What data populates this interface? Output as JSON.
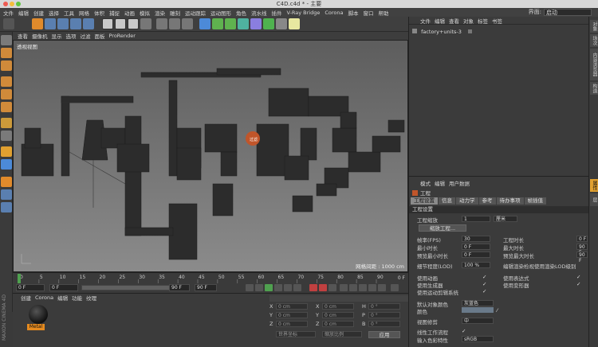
{
  "window": {
    "title": "C4D.c4d * - 主要"
  },
  "menubar": {
    "items": [
      "文件",
      "编辑",
      "创建",
      "选择",
      "工具",
      "网格",
      "体积",
      "捕捉",
      "动画",
      "模拟",
      "渲染",
      "雕刻",
      "运动跟踪",
      "运动图形",
      "角色",
      "流水线",
      "插件",
      "V-Ray Bridge",
      "Corona",
      "脚本",
      "窗口",
      "帮助"
    ],
    "layout_label": "界面:",
    "layout_value": "启动"
  },
  "viewport": {
    "menu": [
      "查看",
      "摄像机",
      "显示",
      "选项",
      "过滤",
      "面板",
      "ProRender"
    ],
    "label": "透视视图",
    "grid_distance": "网格间距 : 1000 cm",
    "highlight_tag": "过滤"
  },
  "timeline": {
    "ticks": [
      "0",
      "5",
      "10",
      "15",
      "20",
      "25",
      "30",
      "35",
      "40",
      "45",
      "50",
      "55",
      "60",
      "65",
      "70",
      "75",
      "80",
      "85",
      "90"
    ],
    "end_label": "0 F"
  },
  "transport": {
    "current": "0 F",
    "start": "0 F",
    "end": "90 F",
    "end2": "90 F"
  },
  "material": {
    "menu": [
      "创建",
      "Corona",
      "编辑",
      "功能",
      "纹理"
    ],
    "name": "Metal"
  },
  "coords": {
    "rows": [
      {
        "a": "X",
        "av": "0 cm",
        "b": "X",
        "bv": "0 cm",
        "c": "H",
        "cv": "0 °"
      },
      {
        "a": "Y",
        "av": "0 cm",
        "b": "Y",
        "bv": "0 cm",
        "c": "P",
        "cv": "0 °"
      },
      {
        "a": "Z",
        "av": "0 cm",
        "b": "Z",
        "bv": "0 cm",
        "c": "B",
        "cv": "0 °"
      }
    ],
    "mode1": "世界坐标",
    "mode2": "缩放比例",
    "apply": "应用"
  },
  "object_manager": {
    "menu": [
      "文件",
      "编辑",
      "查看",
      "对象",
      "标签",
      "书签"
    ],
    "object": "factory+units-3"
  },
  "attributes": {
    "menu": [
      "模式",
      "编辑",
      "用户数据"
    ],
    "title": "工程",
    "tabs": [
      "工程设置",
      "信息",
      "动力学",
      "参考",
      "待办事项",
      "帧插值"
    ],
    "section": "工程设置",
    "scale_label": "工程缩放",
    "scale_value": "1",
    "scale_unit": "厘米",
    "scale_button": "缩放工程...",
    "fps_label": "帧率(FPS)",
    "fps_value": "30",
    "min_label": "最小时长",
    "min_value": "0 F",
    "prev_min_label": "预览最小时长",
    "prev_min_value": "0 F",
    "proj_time_label": "工程时长",
    "proj_time_value": "0 F",
    "max_label": "最大时长",
    "max_value": "90 F",
    "prev_max_label": "预览最大时长",
    "prev_max_value": "90 F",
    "lod_label": "细节程度(LOD)",
    "lod_value": "100 %",
    "lod_check_label": "编辑渲染检视使用渲染LOD级别",
    "anim_label": "使用动画",
    "expr_label": "使用表达式",
    "gen_label": "使用生成器",
    "deform_label": "使用变形器",
    "motion_label": "使用运动剪辑系统",
    "def_obj_color_label": "默认对象颜色",
    "def_obj_color_value": "灰蓝色",
    "color_label": "颜色",
    "view_clip_label": "视图修剪",
    "view_clip_value": "中",
    "linear_label": "线性工作流程",
    "input_color_label": "输入色彩特性",
    "input_color_value": "sRGB"
  },
  "side_tabs": [
    "对象",
    "场次",
    "内容浏览器",
    "构造"
  ],
  "side_tabs_bottom": [
    "属性",
    "层"
  ],
  "brand": "MAXON CINEMA 4D"
}
